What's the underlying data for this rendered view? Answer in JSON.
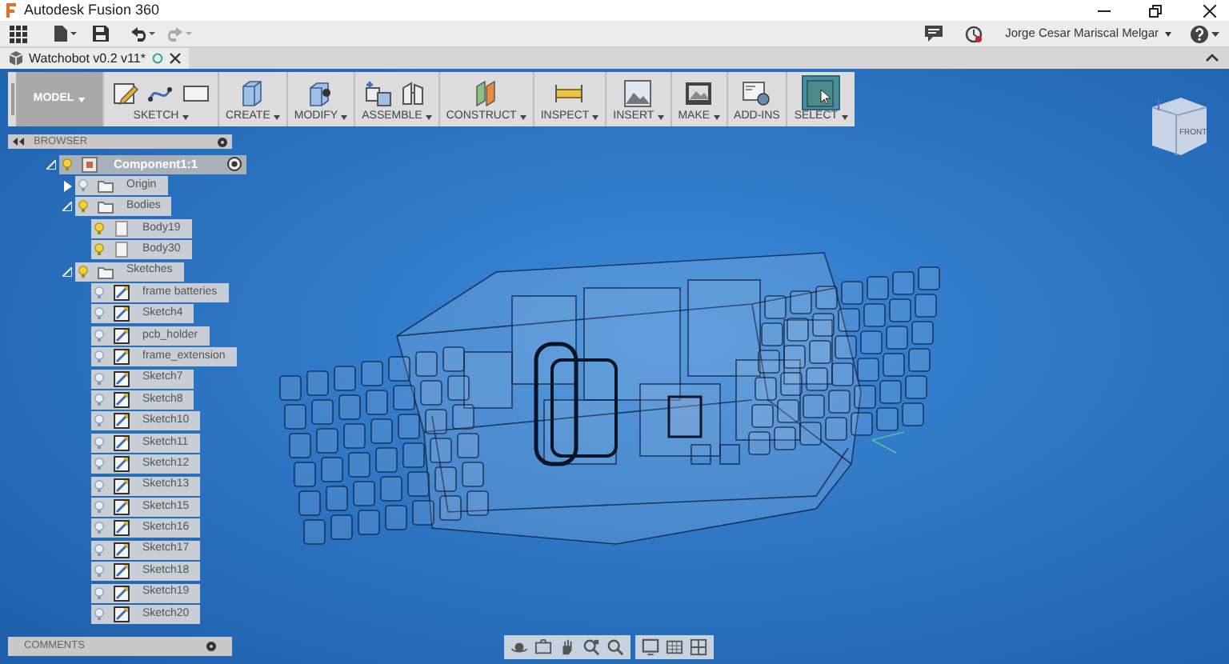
{
  "window": {
    "title": "Autodesk Fusion 360"
  },
  "user": {
    "name": "Jorge Cesar Mariscal Melgar"
  },
  "document_tab": {
    "title": "Watchobot v0.2 v11*"
  },
  "toolbar": {
    "workspace": "MODEL",
    "groups": [
      {
        "label": "SKETCH",
        "dropdown": true,
        "selected": false,
        "icons": [
          {
            "kind": "sketch"
          },
          {
            "kind": "spline"
          },
          {
            "kind": "rectangle"
          }
        ]
      },
      {
        "label": "CREATE",
        "dropdown": true,
        "selected": false,
        "icons": [
          {
            "kind": "box"
          }
        ]
      },
      {
        "label": "MODIFY",
        "dropdown": true,
        "selected": false,
        "icons": [
          {
            "kind": "presspull"
          }
        ]
      },
      {
        "label": "ASSEMBLE",
        "dropdown": true,
        "selected": false,
        "icons": [
          {
            "kind": "component"
          },
          {
            "kind": "joint"
          }
        ]
      },
      {
        "label": "CONSTRUCT",
        "dropdown": true,
        "selected": false,
        "icons": [
          {
            "kind": "plane"
          }
        ]
      },
      {
        "label": "INSPECT",
        "dropdown": true,
        "selected": false,
        "icons": [
          {
            "kind": "measure"
          }
        ]
      },
      {
        "label": "INSERT",
        "dropdown": true,
        "selected": false,
        "icons": [
          {
            "kind": "image"
          }
        ]
      },
      {
        "label": "MAKE",
        "dropdown": true,
        "selected": false,
        "icons": [
          {
            "kind": "print"
          }
        ]
      },
      {
        "label": "ADD-INS",
        "dropdown": false,
        "selected": false,
        "icons": [
          {
            "kind": "addin"
          }
        ]
      },
      {
        "label": "SELECT",
        "dropdown": true,
        "selected": true,
        "icons": [
          {
            "kind": "select"
          }
        ]
      }
    ]
  },
  "browser": {
    "title": "BROWSER",
    "tree": [
      {
        "label": "Component1:1",
        "kind": "component",
        "visible": true,
        "expanded": true,
        "active": true,
        "children": [
          {
            "label": "Origin",
            "kind": "folder",
            "visible": false,
            "expanded": false
          },
          {
            "label": "Bodies",
            "kind": "folder",
            "visible": true,
            "expanded": true,
            "children": [
              {
                "label": "Body19",
                "kind": "body",
                "visible": true
              },
              {
                "label": "Body30",
                "kind": "body",
                "visible": true
              }
            ]
          },
          {
            "label": "Sketches",
            "kind": "folder",
            "visible": true,
            "expanded": true,
            "children": [
              {
                "label": "frame batteries",
                "kind": "sketch",
                "visible": false
              },
              {
                "label": "Sketch4",
                "kind": "sketch",
                "visible": false
              },
              {
                "label": "pcb_holder",
                "kind": "sketch",
                "visible": false
              },
              {
                "label": "frame_extension",
                "kind": "sketch",
                "visible": false
              },
              {
                "label": "Sketch7",
                "kind": "sketch",
                "visible": false
              },
              {
                "label": "Sketch8",
                "kind": "sketch",
                "visible": false
              },
              {
                "label": "Sketch10",
                "kind": "sketch",
                "visible": false
              },
              {
                "label": "Sketch11",
                "kind": "sketch",
                "visible": false
              },
              {
                "label": "Sketch12",
                "kind": "sketch",
                "visible": false
              },
              {
                "label": "Sketch13",
                "kind": "sketch",
                "visible": false
              },
              {
                "label": "Sketch15",
                "kind": "sketch",
                "visible": false
              },
              {
                "label": "Sketch16",
                "kind": "sketch",
                "visible": false
              },
              {
                "label": "Sketch17",
                "kind": "sketch",
                "visible": false
              },
              {
                "label": "Sketch18",
                "kind": "sketch",
                "visible": false
              },
              {
                "label": "Sketch19",
                "kind": "sketch",
                "visible": false
              },
              {
                "label": "Sketch20",
                "kind": "sketch",
                "visible": false
              }
            ]
          }
        ]
      }
    ]
  },
  "comments": {
    "title": "COMMENTS"
  },
  "view_cube": {
    "label": "FRONT"
  }
}
